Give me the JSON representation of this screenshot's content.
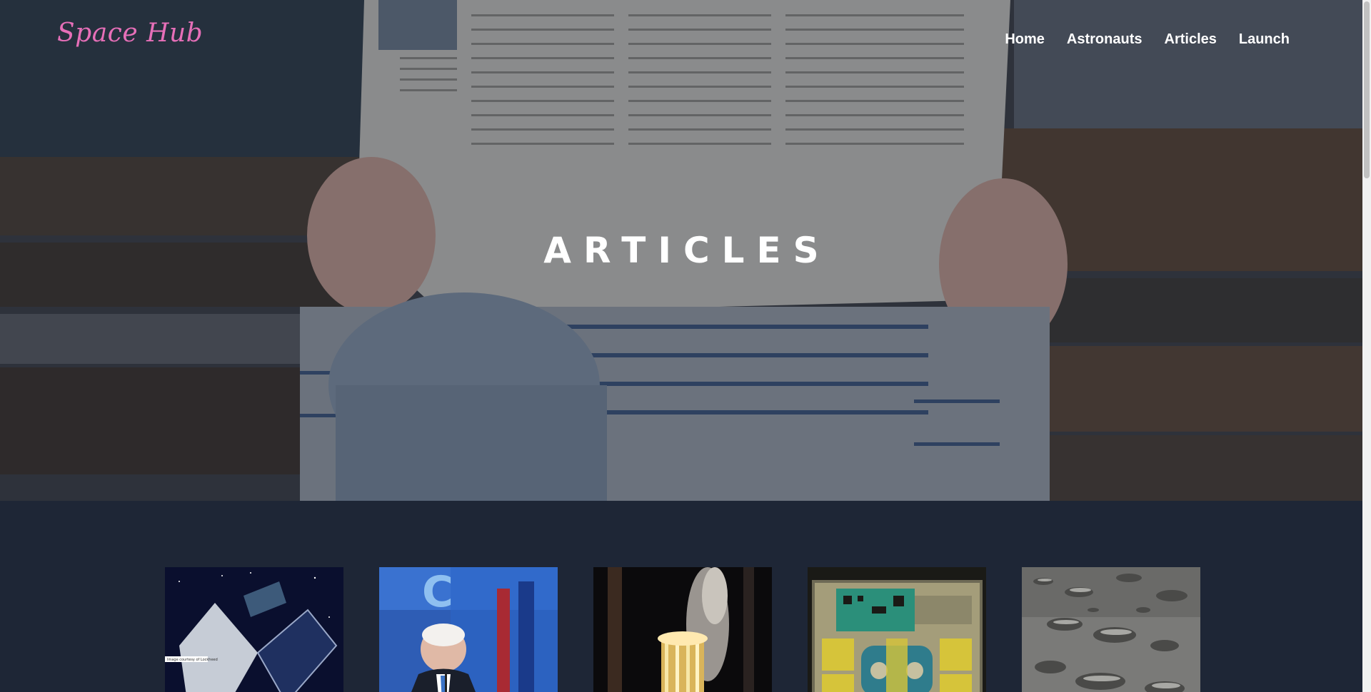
{
  "header": {
    "brand": "Space Hub",
    "nav": [
      {
        "label": "Home"
      },
      {
        "label": "Astronauts"
      },
      {
        "label": "Articles"
      },
      {
        "label": "Launch"
      }
    ]
  },
  "hero": {
    "title": "ARTICLES"
  },
  "articles": [
    {
      "image": "satellite-in-orbit",
      "caption": "Image courtesy of Lockheed"
    },
    {
      "image": "speaker-at-podium"
    },
    {
      "image": "rocket-launch-flame"
    },
    {
      "image": "circuit-board-hardware"
    },
    {
      "image": "moon-surface-craters"
    }
  ],
  "colors": {
    "brand": "#e66fb8",
    "page_background": "#1e2636",
    "nav_text": "#ffffff"
  }
}
